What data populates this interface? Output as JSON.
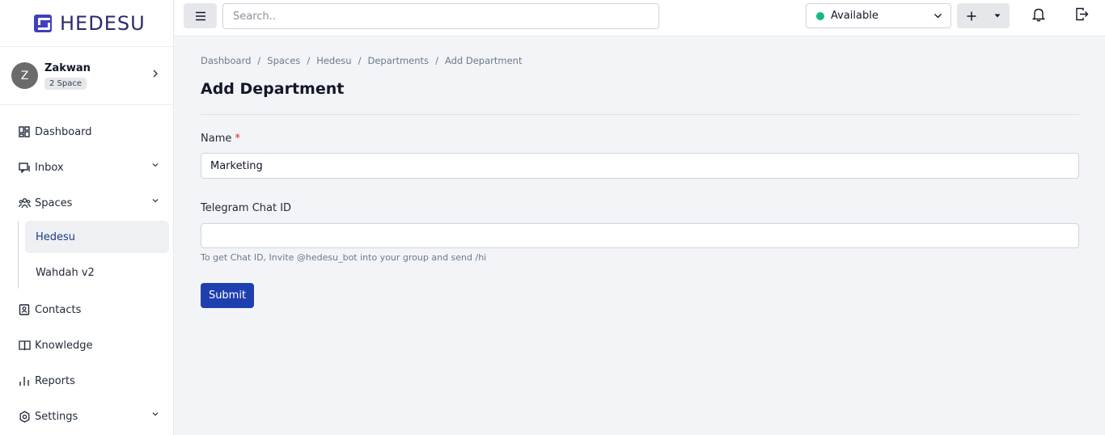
{
  "brand": {
    "name": "HEDESU"
  },
  "user": {
    "initial": "Z",
    "name": "Zakwan",
    "badge": "2 Space"
  },
  "nav": {
    "dashboard": "Dashboard",
    "inbox": "Inbox",
    "spaces": "Spaces",
    "spaces_items": [
      "Hedesu",
      "Wahdah v2"
    ],
    "contacts": "Contacts",
    "knowledge": "Knowledge",
    "reports": "Reports",
    "settings": "Settings"
  },
  "topbar": {
    "search_placeholder": "Search..",
    "status": "Available",
    "status_color": "#14b886"
  },
  "breadcrumb": [
    "Dashboard",
    "Spaces",
    "Hedesu",
    "Departments",
    "Add Department"
  ],
  "page": {
    "title": "Add Department"
  },
  "form": {
    "name_label": "Name",
    "name_required": "*",
    "name_value": "Marketing",
    "telegram_label": "Telegram Chat ID",
    "telegram_value": "",
    "telegram_hint": "To get Chat ID, Invite @hedesu_bot into your group and send /hi",
    "submit_label": "Submit"
  },
  "colors": {
    "primary": "#1e40af",
    "brand": "#3f3fbf"
  }
}
